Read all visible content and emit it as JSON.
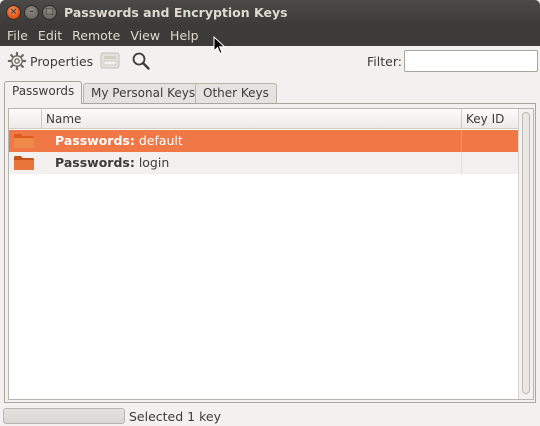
{
  "window": {
    "title": "Passwords and Encryption Keys"
  },
  "menubar": {
    "items": [
      "File",
      "Edit",
      "Remote",
      "View",
      "Help"
    ]
  },
  "toolbar": {
    "properties_label": "Properties",
    "properties_icon": "gear-icon",
    "export_icon": "export-icon",
    "search_icon": "magnifier-icon",
    "filter_label": "Filter:",
    "filter_value": ""
  },
  "tabs": [
    {
      "label": "Passwords",
      "active": true
    },
    {
      "label": "My Personal Keys",
      "active": false
    },
    {
      "label": "Other Keys",
      "active": false
    }
  ],
  "columns": {
    "name": "Name",
    "key_id": "Key ID"
  },
  "rows": [
    {
      "prefix": "Passwords:",
      "name": "default",
      "key_id": "",
      "selected": true,
      "icon": "folder-icon"
    },
    {
      "prefix": "Passwords:",
      "name": "login",
      "key_id": "",
      "selected": false,
      "icon": "folder-icon"
    }
  ],
  "status": {
    "text": "Selected 1 key"
  },
  "colors": {
    "selection": "#f07746",
    "titlebar": "#3c3b37",
    "window_bg": "#f2f1f0"
  }
}
